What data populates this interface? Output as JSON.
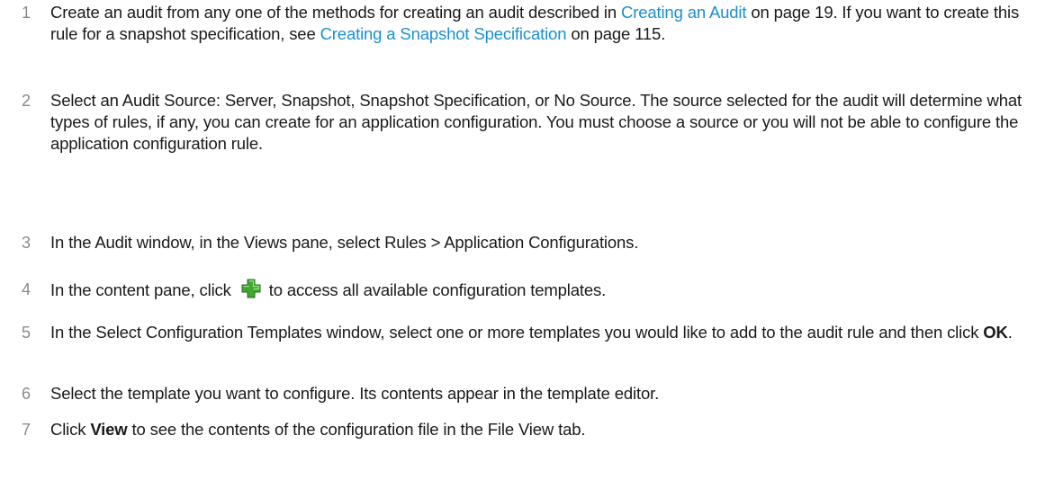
{
  "steps": [
    {
      "number": "1",
      "text_a": "Create an audit from any one of the methods for creating an audit described in ",
      "link_a": "Creating an Audit",
      "text_b": " on page 19. If you want to create this rule for a snapshot specification, see ",
      "link_b": "Creating a Snapshot Specification",
      "text_c": " on page 115."
    },
    {
      "number": "2",
      "text": "Select an Audit Source: Server, Snapshot, Snapshot Specification, or No Source. The source selected for the audit will determine what types of rules, if any, you can create for an application configuration. You must choose a source or you will not be able to configure the application configuration rule."
    },
    {
      "number": "3",
      "text": "In the Audit window, in the Views pane, select Rules > Application Configurations."
    },
    {
      "number": "4",
      "text_a": "In the content pane, click ",
      "icon": "green-plus-icon",
      "text_b": " to access all available configuration templates."
    },
    {
      "number": "5",
      "text_a": "In the Select Configuration Templates window, select one or more templates you would like to add to the audit rule and then click ",
      "bold": "OK",
      "text_b": "."
    },
    {
      "number": "6",
      "text": "Select the template you want to configure. Its contents appear in the template editor."
    },
    {
      "number": "7",
      "text_a": "Click ",
      "bold": "View",
      "text_b": " to see the contents of the configuration file in the File View tab."
    }
  ],
  "colors": {
    "text": "#1a1a1a",
    "number": "#8a8a8a",
    "link": "#1a8fd1",
    "icon_green": "#3fa82f"
  }
}
